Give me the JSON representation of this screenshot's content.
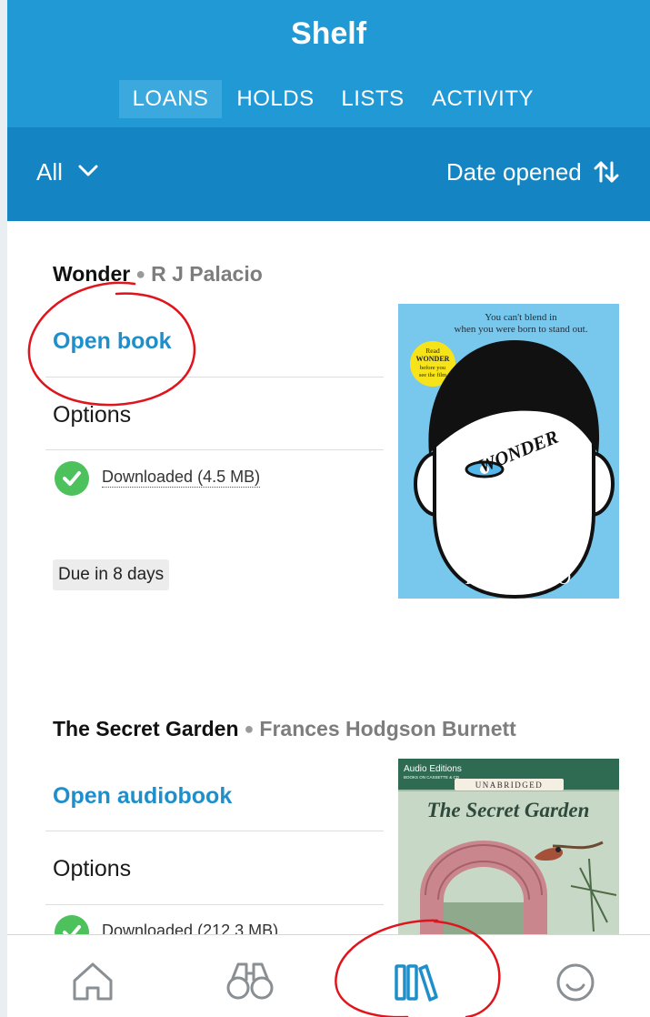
{
  "header": {
    "title": "Shelf",
    "tabs": [
      {
        "label": "LOANS",
        "active": true
      },
      {
        "label": "HOLDS",
        "active": false
      },
      {
        "label": "LISTS",
        "active": false
      },
      {
        "label": "ACTIVITY",
        "active": false
      }
    ]
  },
  "toolbar": {
    "filter_label": "All",
    "sort_label": "Date opened"
  },
  "loans": [
    {
      "title": "Wonder",
      "author": "R J Palacio",
      "action_label": "Open book",
      "options_label": "Options",
      "download_label": "Downloaded (4.5 MB)",
      "due_label": "Due in 8 days",
      "cover": {
        "tagline_1": "You can't blend in",
        "tagline_2": "when you were born to stand out.",
        "badge_1": "Read",
        "badge_2": "WONDER",
        "badge_3": "before you",
        "badge_4": "see the film",
        "title": "WONDER",
        "author": "R.J. PALACIO",
        "bg_color": "#78c7ec"
      }
    },
    {
      "title": "The Secret Garden",
      "author": "Frances Hodgson Burnett",
      "action_label": "Open audiobook",
      "options_label": "Options",
      "download_label": "Downloaded (212.3 MB)",
      "cover": {
        "publisher": "Audio Editions",
        "publisher_sub": "BOOKS ON CASSETTE & CD",
        "edition": "UNABRIDGED",
        "title": "The Secret Garden",
        "bg_color": "#9dbfa4"
      }
    }
  ],
  "bottom_nav": [
    {
      "icon": "home-icon"
    },
    {
      "icon": "binoculars-icon"
    },
    {
      "icon": "bookshelf-icon",
      "active": true
    },
    {
      "icon": "smiley-face-icon"
    }
  ],
  "colors": {
    "header": "#2199d4",
    "subbar": "#1484c2",
    "accent": "#1f8fcb",
    "success": "#4cc15c",
    "annotation": "#e0141c"
  }
}
